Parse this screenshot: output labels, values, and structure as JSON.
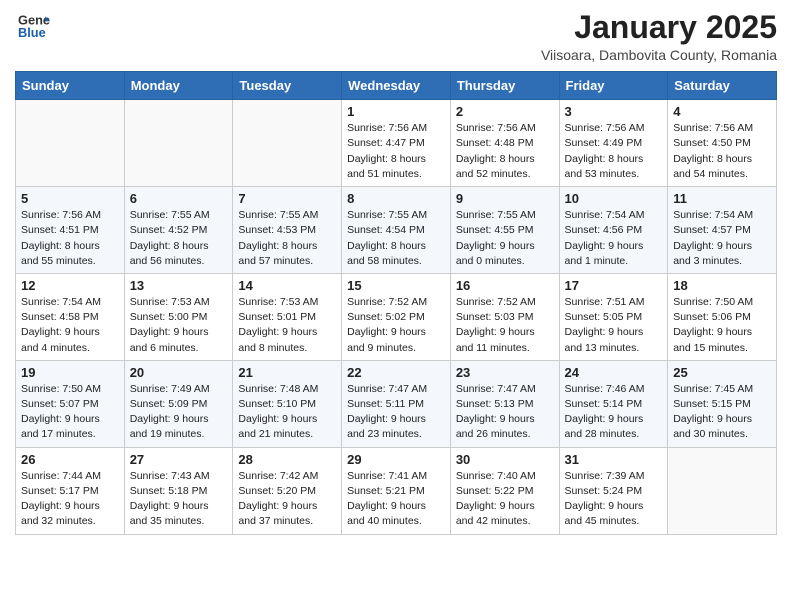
{
  "header": {
    "logo_line1": "General",
    "logo_line2": "Blue",
    "month": "January 2025",
    "location": "Viisoara, Dambovita County, Romania"
  },
  "weekdays": [
    "Sunday",
    "Monday",
    "Tuesday",
    "Wednesday",
    "Thursday",
    "Friday",
    "Saturday"
  ],
  "weeks": [
    [
      {
        "day": "",
        "info": ""
      },
      {
        "day": "",
        "info": ""
      },
      {
        "day": "",
        "info": ""
      },
      {
        "day": "1",
        "info": "Sunrise: 7:56 AM\nSunset: 4:47 PM\nDaylight: 8 hours and 51 minutes."
      },
      {
        "day": "2",
        "info": "Sunrise: 7:56 AM\nSunset: 4:48 PM\nDaylight: 8 hours and 52 minutes."
      },
      {
        "day": "3",
        "info": "Sunrise: 7:56 AM\nSunset: 4:49 PM\nDaylight: 8 hours and 53 minutes."
      },
      {
        "day": "4",
        "info": "Sunrise: 7:56 AM\nSunset: 4:50 PM\nDaylight: 8 hours and 54 minutes."
      }
    ],
    [
      {
        "day": "5",
        "info": "Sunrise: 7:56 AM\nSunset: 4:51 PM\nDaylight: 8 hours and 55 minutes."
      },
      {
        "day": "6",
        "info": "Sunrise: 7:55 AM\nSunset: 4:52 PM\nDaylight: 8 hours and 56 minutes."
      },
      {
        "day": "7",
        "info": "Sunrise: 7:55 AM\nSunset: 4:53 PM\nDaylight: 8 hours and 57 minutes."
      },
      {
        "day": "8",
        "info": "Sunrise: 7:55 AM\nSunset: 4:54 PM\nDaylight: 8 hours and 58 minutes."
      },
      {
        "day": "9",
        "info": "Sunrise: 7:55 AM\nSunset: 4:55 PM\nDaylight: 9 hours and 0 minutes."
      },
      {
        "day": "10",
        "info": "Sunrise: 7:54 AM\nSunset: 4:56 PM\nDaylight: 9 hours and 1 minute."
      },
      {
        "day": "11",
        "info": "Sunrise: 7:54 AM\nSunset: 4:57 PM\nDaylight: 9 hours and 3 minutes."
      }
    ],
    [
      {
        "day": "12",
        "info": "Sunrise: 7:54 AM\nSunset: 4:58 PM\nDaylight: 9 hours and 4 minutes."
      },
      {
        "day": "13",
        "info": "Sunrise: 7:53 AM\nSunset: 5:00 PM\nDaylight: 9 hours and 6 minutes."
      },
      {
        "day": "14",
        "info": "Sunrise: 7:53 AM\nSunset: 5:01 PM\nDaylight: 9 hours and 8 minutes."
      },
      {
        "day": "15",
        "info": "Sunrise: 7:52 AM\nSunset: 5:02 PM\nDaylight: 9 hours and 9 minutes."
      },
      {
        "day": "16",
        "info": "Sunrise: 7:52 AM\nSunset: 5:03 PM\nDaylight: 9 hours and 11 minutes."
      },
      {
        "day": "17",
        "info": "Sunrise: 7:51 AM\nSunset: 5:05 PM\nDaylight: 9 hours and 13 minutes."
      },
      {
        "day": "18",
        "info": "Sunrise: 7:50 AM\nSunset: 5:06 PM\nDaylight: 9 hours and 15 minutes."
      }
    ],
    [
      {
        "day": "19",
        "info": "Sunrise: 7:50 AM\nSunset: 5:07 PM\nDaylight: 9 hours and 17 minutes."
      },
      {
        "day": "20",
        "info": "Sunrise: 7:49 AM\nSunset: 5:09 PM\nDaylight: 9 hours and 19 minutes."
      },
      {
        "day": "21",
        "info": "Sunrise: 7:48 AM\nSunset: 5:10 PM\nDaylight: 9 hours and 21 minutes."
      },
      {
        "day": "22",
        "info": "Sunrise: 7:47 AM\nSunset: 5:11 PM\nDaylight: 9 hours and 23 minutes."
      },
      {
        "day": "23",
        "info": "Sunrise: 7:47 AM\nSunset: 5:13 PM\nDaylight: 9 hours and 26 minutes."
      },
      {
        "day": "24",
        "info": "Sunrise: 7:46 AM\nSunset: 5:14 PM\nDaylight: 9 hours and 28 minutes."
      },
      {
        "day": "25",
        "info": "Sunrise: 7:45 AM\nSunset: 5:15 PM\nDaylight: 9 hours and 30 minutes."
      }
    ],
    [
      {
        "day": "26",
        "info": "Sunrise: 7:44 AM\nSunset: 5:17 PM\nDaylight: 9 hours and 32 minutes."
      },
      {
        "day": "27",
        "info": "Sunrise: 7:43 AM\nSunset: 5:18 PM\nDaylight: 9 hours and 35 minutes."
      },
      {
        "day": "28",
        "info": "Sunrise: 7:42 AM\nSunset: 5:20 PM\nDaylight: 9 hours and 37 minutes."
      },
      {
        "day": "29",
        "info": "Sunrise: 7:41 AM\nSunset: 5:21 PM\nDaylight: 9 hours and 40 minutes."
      },
      {
        "day": "30",
        "info": "Sunrise: 7:40 AM\nSunset: 5:22 PM\nDaylight: 9 hours and 42 minutes."
      },
      {
        "day": "31",
        "info": "Sunrise: 7:39 AM\nSunset: 5:24 PM\nDaylight: 9 hours and 45 minutes."
      },
      {
        "day": "",
        "info": ""
      }
    ]
  ]
}
